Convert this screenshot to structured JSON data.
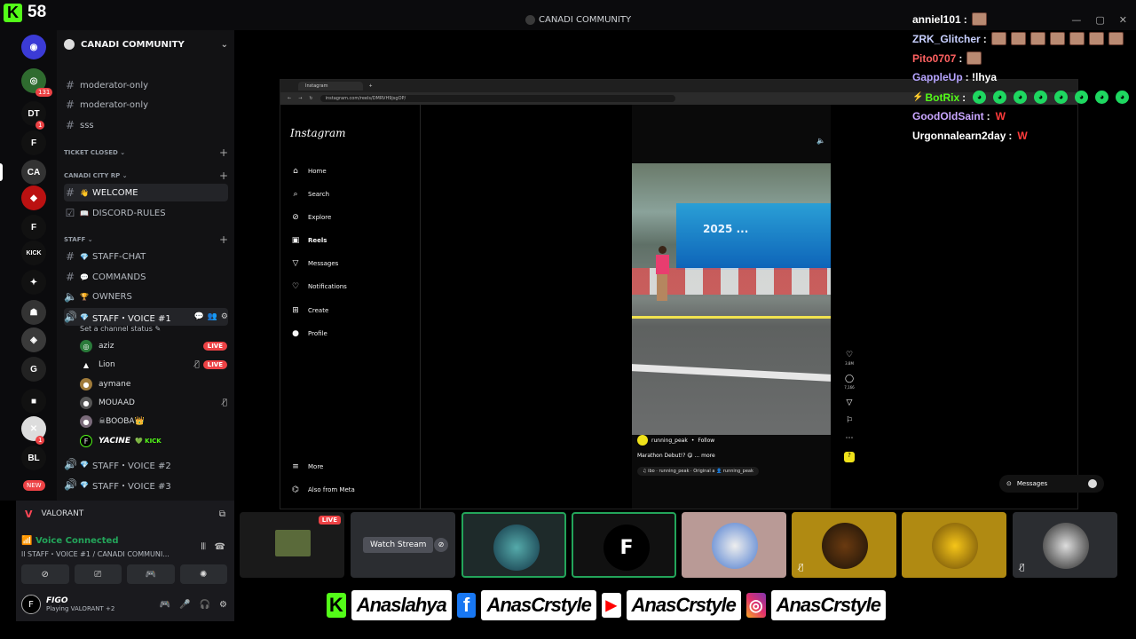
{
  "window": {
    "title": "CANADI COMMUNITY",
    "buttons": [
      "—",
      "▢",
      "✕"
    ]
  },
  "kick_counter": {
    "logo": "K",
    "value": "58"
  },
  "rail": {
    "servers": [
      {
        "name": "server-1",
        "y": 0,
        "color": "#3b3bd6",
        "glyph": "◉"
      },
      {
        "name": "server-2",
        "y": 1,
        "color": "#2f6b2f",
        "glyph": "◎",
        "badge": "131"
      },
      {
        "name": "server-3",
        "y": 2,
        "color": "#111",
        "glyph": "DT",
        "badge": "1"
      },
      {
        "name": "server-4",
        "y": 3,
        "color": "#111",
        "glyph": "F"
      },
      {
        "name": "server-5",
        "y": 4,
        "color": "#333",
        "glyph": "CA",
        "active": true
      },
      {
        "name": "server-6",
        "y": 5,
        "color": "#b11",
        "glyph": "◆"
      },
      {
        "name": "server-7",
        "y": 6,
        "color": "#111",
        "glyph": "F"
      },
      {
        "name": "server-8",
        "y": 7,
        "color": "#111",
        "glyph": "KICK"
      },
      {
        "name": "server-9",
        "y": 8,
        "color": "#111",
        "glyph": "✦"
      },
      {
        "name": "server-10",
        "y": 9,
        "color": "#333",
        "glyph": "☗"
      },
      {
        "name": "server-11",
        "y": 10,
        "color": "#3a3a3a",
        "glyph": "◈"
      },
      {
        "name": "server-12",
        "y": 11,
        "color": "#222",
        "glyph": "G"
      },
      {
        "name": "server-13",
        "y": 12,
        "color": "#111",
        "glyph": "■"
      },
      {
        "name": "server-14",
        "y": 13,
        "color": "#ddd",
        "glyph": "✕",
        "badge": "1"
      },
      {
        "name": "server-15",
        "y": 14,
        "color": "#111",
        "glyph": "BL"
      }
    ],
    "new_label": "NEW"
  },
  "sidebar": {
    "guild_name": "CANADI COMMUNITY",
    "channels_top": [
      "moderator-only",
      "moderator-only",
      "sss"
    ],
    "cat_ticket": "TICKET CLOSED",
    "cat_city": "CANADI CITY RP",
    "welcome": "WELCOME",
    "discord_rules": "DISCORD-RULES",
    "cat_staff": "STAFF",
    "staff_chat": "STAFF-CHAT",
    "commands": "COMMANDS",
    "owners": "OWNERS",
    "voice1": "STAFF・VOICE #1",
    "voice_status": "Set a channel status",
    "voice_users": [
      {
        "name": "aziz",
        "live": "LIVE"
      },
      {
        "name": "Lion",
        "live": "LIVE"
      },
      {
        "name": "aymane"
      },
      {
        "name": "MOUAAD"
      },
      {
        "name": "☠BOOBA👑"
      },
      {
        "name": "YACINE",
        "tag": "KICK"
      }
    ],
    "voice2": "STAFF・VOICE #2",
    "voice3": "STAFF・VOICE #3"
  },
  "bottom": {
    "game": "VALORANT",
    "voice_connected": "Voice Connected",
    "voice_sub": "ll STAFF・VOICE #1 / CANADI COMMUNI...",
    "username": "FIGO",
    "user_status": "Playing VALORANT +2",
    "user_initial": "F"
  },
  "browser": {
    "tab_label": "Instagram",
    "url": "instagram.com/reels/DMRVH9jsgOP/",
    "logo": "Instagram",
    "nav": [
      "Home",
      "Search",
      "Explore",
      "Reels",
      "Messages",
      "Notifications",
      "Create",
      "Profile"
    ],
    "more": "More",
    "meta": "Also from Meta",
    "reel_banner": "2025 ...",
    "reel_user": "running_peak",
    "reel_follow": "Follow",
    "reel_caption": "Marathon Debut!? 😋 ... more",
    "reel_audio": "♫ ibo · running_peak · Original a   👤 running_peak",
    "likes": "3.8M",
    "comments": "7,166",
    "messages_pill": "Messages"
  },
  "chat": [
    {
      "user": "anniel101",
      "color": "#ffffff",
      "msg": ":",
      "emotes": 1
    },
    {
      "user": "ZRK_Glitcher",
      "color": "#c8d0ff",
      "msg": ":",
      "emotes": 7
    },
    {
      "user": "Pito0707",
      "color": "#ff6161",
      "msg": ":",
      "emotes": 1
    },
    {
      "user": "GappleUp",
      "color": "#b6a4ff",
      "msg": ": !lhya",
      "emotes": 0
    },
    {
      "user": "BotRix",
      "color": "#53fc18",
      "msg": ":",
      "green_emotes": 8
    },
    {
      "user": "GoodOldSaint",
      "color": "#c9a6ff",
      "msg": ":",
      "w": "W"
    },
    {
      "user": "Urgonnalearn2day",
      "color": "#ffffff",
      "msg": ":",
      "w": "W"
    }
  ],
  "tiles": {
    "live_label": "LIVE",
    "watch_stream": "Watch Stream",
    "tile3_letter": "F"
  },
  "banner": {
    "kick_handle": "Anaslahya",
    "facebook_handle": "AnasCrstyle",
    "youtube_handle": "AnasCrstyle",
    "instagram_handle": "AnasCrstyle"
  }
}
